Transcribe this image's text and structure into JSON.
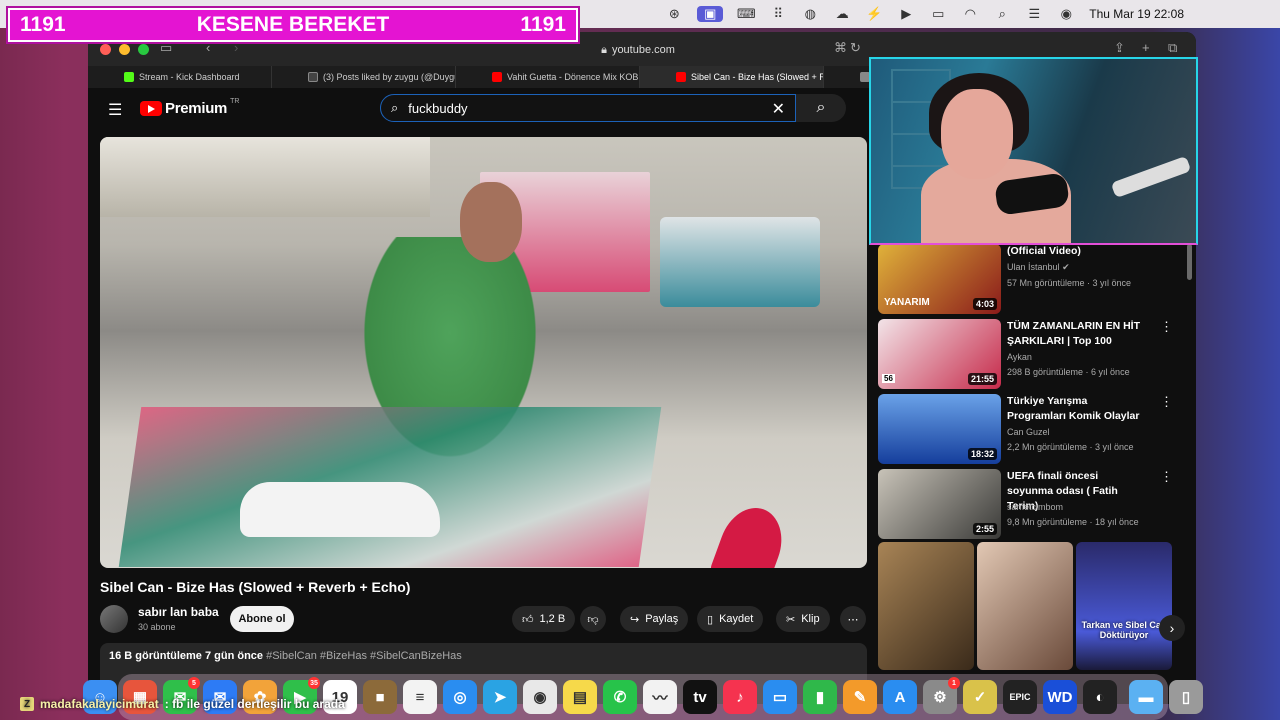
{
  "banner": {
    "left_count": "1191",
    "title": "KESENE BEREKET",
    "right_count": "1191"
  },
  "menubar": {
    "clock": "Thu Mar 19  22:08"
  },
  "browser": {
    "url": "youtube.com",
    "tabs": [
      {
        "label": "Stream - Kick Dashboard",
        "color": "#53fc18",
        "glyph": "K"
      },
      {
        "label": "(3) Posts liked by zuygu (@Duygu...",
        "color": "#444444",
        "glyph": "X"
      },
      {
        "label": "Vahit Guetta - Dönence Mix KOBR...",
        "color": "#ff0000",
        "glyph": "▶"
      },
      {
        "label": "Sibel Can - Bize Has (Slowed + Re...",
        "color": "#ff0000",
        "glyph": "▶"
      },
      {
        "label": "W",
        "color": "#888888",
        "glyph": "W"
      }
    ]
  },
  "youtube": {
    "brand": "Premium",
    "region": "TR",
    "search_value": "fuckbuddy",
    "video": {
      "title": "Sibel Can - Bize Has (Slowed + Reverb + Echo)",
      "channel": "sabır lan baba",
      "subscribers": "30 abone",
      "subscribe_label": "Abone ol",
      "likes": "1,2 B",
      "share_label": "Paylaş",
      "save_label": "Kaydet",
      "clip_label": "Klip",
      "views": "16 B görüntüleme",
      "age": "7 gün önce",
      "hashtags": "#SibelCan #BizeHas #SibelCanBizeHas"
    },
    "recommendations": [
      {
        "title": "(Official Video)",
        "channel": "Ulan İstanbul",
        "verified": true,
        "meta": "57 Mn görüntüleme · 3 yıl önce",
        "duration": "4:03",
        "thumb_text": "YANARIM",
        "thumb_color": "#c9a01e"
      },
      {
        "title": "TÜM ZAMANLARIN EN HİT ŞARKILARI |  Top 100",
        "channel": "Aykan",
        "verified": false,
        "meta": "298 B görüntüleme · 6 yıl önce",
        "duration": "21:55",
        "thumb_text": "56",
        "thumb_color": "#d9334f"
      },
      {
        "title": "Türkiye Yarışma Programları Komik Olaylar",
        "channel": "Can Guzel",
        "verified": false,
        "meta": "2,2 Mn görüntüleme · 3 yıl önce",
        "duration": "18:32",
        "thumb_text": "",
        "thumb_color": "#1b4fb8"
      },
      {
        "title": "UEFA finali öncesi soyunma odası ( Fatih Terim)",
        "channel": "sametcimbom",
        "verified": false,
        "meta": "9,8 Mn görüntüleme · 18 yıl önce",
        "duration": "2:55",
        "thumb_text": "",
        "thumb_color": "#7d7a72"
      }
    ],
    "shorts": [
      {
        "caption": "",
        "color": "#8a6a40"
      },
      {
        "caption": "",
        "color": "#b89a80"
      },
      {
        "caption": "Tarkan ve Sibel Can Döktürüyor",
        "color": "#2a3a9a"
      }
    ]
  },
  "dock": {
    "apps": [
      {
        "name": "finder",
        "color": "#3b8ff2",
        "glyph": "☺",
        "badge": ""
      },
      {
        "name": "launchpad",
        "color": "#e7553c",
        "glyph": "▦",
        "badge": ""
      },
      {
        "name": "messages-alt",
        "color": "#2fbf4a",
        "glyph": "✉",
        "badge": "5"
      },
      {
        "name": "mail",
        "color": "#2d7bf5",
        "glyph": "✉",
        "badge": ""
      },
      {
        "name": "photos",
        "color": "#f2a33a",
        "glyph": "✿",
        "badge": ""
      },
      {
        "name": "facetime",
        "color": "#2fbf4a",
        "glyph": "▶",
        "badge": "35"
      },
      {
        "name": "calendar",
        "color": "#ffffff",
        "glyph": "19",
        "badge": ""
      },
      {
        "name": "notes-brown",
        "color": "#8c6a3a",
        "glyph": "■",
        "badge": ""
      },
      {
        "name": "reminders",
        "color": "#f3f3f3",
        "glyph": "≡",
        "badge": ""
      },
      {
        "name": "safari",
        "color": "#2a8df0",
        "glyph": "◎",
        "badge": ""
      },
      {
        "name": "telegram",
        "color": "#2aa3e3",
        "glyph": "➤",
        "badge": ""
      },
      {
        "name": "chrome",
        "color": "#e8e8e8",
        "glyph": "◉",
        "badge": ""
      },
      {
        "name": "notes",
        "color": "#f6d94a",
        "glyph": "▤",
        "badge": ""
      },
      {
        "name": "whatsapp",
        "color": "#27c34a",
        "glyph": "✆",
        "badge": ""
      },
      {
        "name": "freeform",
        "color": "#f2f2f2",
        "glyph": "〰",
        "badge": ""
      },
      {
        "name": "apple-tv",
        "color": "#111111",
        "glyph": "tv",
        "badge": ""
      },
      {
        "name": "music",
        "color": "#f5334f",
        "glyph": "♪",
        "badge": ""
      },
      {
        "name": "keynote",
        "color": "#2a8df0",
        "glyph": "▭",
        "badge": ""
      },
      {
        "name": "numbers",
        "color": "#2fb84a",
        "glyph": "▮",
        "badge": ""
      },
      {
        "name": "pages",
        "color": "#f39a2a",
        "glyph": "✎",
        "badge": ""
      },
      {
        "name": "app-store",
        "color": "#2a8df0",
        "glyph": "A",
        "badge": ""
      },
      {
        "name": "system-settings",
        "color": "#8a8a8a",
        "glyph": "⚙",
        "badge": "1"
      },
      {
        "name": "xcode-alt",
        "color": "#d9c24a",
        "glyph": "✓",
        "badge": ""
      },
      {
        "name": "epic-games",
        "color": "#222222",
        "glyph": "EPIC",
        "badge": ""
      },
      {
        "name": "wd",
        "color": "#1a4fd8",
        "glyph": "WD",
        "badge": ""
      },
      {
        "name": "obs",
        "color": "#222222",
        "glyph": "◐",
        "badge": ""
      },
      {
        "name": "downloads",
        "color": "#5bb1f2",
        "glyph": "▬",
        "badge": ""
      },
      {
        "name": "trash",
        "color": "#9a9a9a",
        "glyph": "▯",
        "badge": ""
      }
    ]
  },
  "chat": {
    "username": "madafakalayicimurat",
    "message": ": fb ile güzel dertleşilir bu arada"
  }
}
